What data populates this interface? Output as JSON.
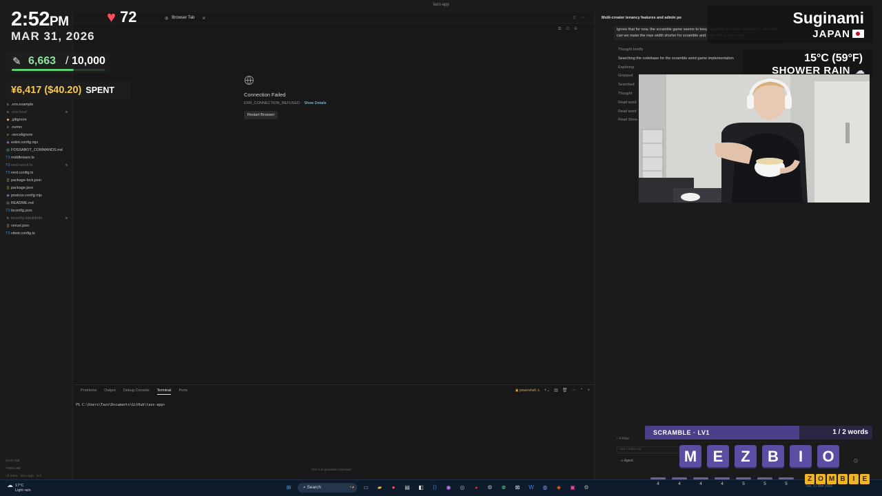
{
  "ide": {
    "app_title": "tazo-app",
    "files": [
      {
        "name": ".env.example",
        "icon": "≡",
        "dim": false,
        "dot": false
      },
      {
        "name": ".env.local",
        "icon": "≡",
        "dim": true,
        "dot": true
      },
      {
        "name": ".gitignore",
        "icon": "◆",
        "dim": false,
        "dot": false
      },
      {
        "name": ".nvmrc",
        "icon": "≡",
        "dim": false,
        "dot": false
      },
      {
        "name": ".vercelignore",
        "icon": "≡",
        "dim": false,
        "dot": false
      },
      {
        "name": "eslint.config.mjs",
        "icon": "◉",
        "dim": false,
        "dot": false
      },
      {
        "name": "FOSSABOT_COMMANDS.md",
        "icon": "▤",
        "dim": false,
        "dot": false
      },
      {
        "name": "middleware.ts",
        "icon": "TS",
        "dim": false,
        "dot": false
      },
      {
        "name": "next-env.d.ts",
        "icon": "TS",
        "dim": true,
        "dot": true
      },
      {
        "name": "next.config.ts",
        "icon": "TS",
        "dim": false,
        "dot": false
      },
      {
        "name": "package-lock.json",
        "icon": "{}",
        "dim": false,
        "dot": false
      },
      {
        "name": "package.json",
        "icon": "{}",
        "dim": false,
        "dot": false
      },
      {
        "name": "postcss.config.mjs",
        "icon": "◉",
        "dim": false,
        "dot": false
      },
      {
        "name": "README.md",
        "icon": "▤",
        "dim": false,
        "dot": false
      },
      {
        "name": "tsconfig.json",
        "icon": "TS",
        "dim": false,
        "dot": false
      },
      {
        "name": "tsconfig.tsbuildinfo",
        "icon": "≡",
        "dim": true,
        "dot": true
      },
      {
        "name": "vercel.json",
        "icon": "{}",
        "dim": false,
        "dot": false
      },
      {
        "name": "vitest.config.ts",
        "icon": "TS",
        "dim": false,
        "dot": false
      }
    ],
    "outline_label": "OUTLINE",
    "timeline_label": "TIMELINE",
    "status_branch": "main",
    "status_project": "tazo-app",
    "status_errors": "0  0",
    "browser_tab": "Browser Tab",
    "connection": {
      "title": "Connection Failed",
      "error": "ERR_CONNECTION_REFUSED",
      "details_link": "Show Details",
      "restart_button": "Restart Browser"
    },
    "panel_tabs": [
      "Problems",
      "Output",
      "Debug Console",
      "Terminal",
      "Ports"
    ],
    "panel_active": "Terminal",
    "shell_label": "powershell",
    "terminal_prompt": "PS C:\\Users\\Tazo\\Documents\\GitHub\\tazo-app>",
    "ctrl_hint": "Ctrl+K to generate command",
    "chat": {
      "title": "Multi-creator tenancy features and admin po",
      "message": "ignore that for now. the scramble game seems to keep repeating the same word for t... this, also can we make the max width shorter for scramble and make the answer lette...",
      "steps": [
        {
          "text": "Thought briefly",
          "bright": false
        },
        {
          "text": "Searching the codebase for the scramble word game implementation",
          "bright": true
        },
        {
          "text": "Exploring",
          "bright": false
        },
        {
          "text": "Grepped",
          "bright": false
        },
        {
          "text": "Searched",
          "bright": false
        },
        {
          "text": "Thought",
          "bright": false
        },
        {
          "text": "Read word",
          "bright": false
        },
        {
          "text": "Read word",
          "bright": false
        },
        {
          "text": "Read Strea",
          "bright": false
        }
      ],
      "files_label": "4 Files",
      "input_placeholder": "Add a follow-up",
      "agent_label": "Agent"
    }
  },
  "taskbar": {
    "temp": "17°C",
    "condition": "Light rain",
    "search_label": "Search",
    "clock": "Tue, 31 Mar 2026"
  },
  "overlay": {
    "time": "2:52",
    "ampm": "PM",
    "date": "MAR 31, 2026",
    "heart_rate": "72",
    "steps_current": "6,663",
    "steps_goal": "10,000",
    "steps_progress": 0.6663,
    "spent_yen": "¥6,417",
    "spent_usd": "($40.20)",
    "spent_label": "SPENT",
    "location_name": "Suginami",
    "location_country": "JAPAN",
    "weather_temp": "15°C (59°F)",
    "weather_condition": "SHOWER RAIN"
  },
  "scramble": {
    "title": "SCRAMBLE · LV1",
    "count": "1 / 2 words",
    "progress": 0.68,
    "letters": [
      "M",
      "E",
      "Z",
      "B",
      "I",
      "O"
    ],
    "slot_numbers": [
      "4",
      "4",
      "4",
      "4",
      "5",
      "5",
      "5"
    ],
    "answer": [
      "Z",
      "O",
      "M",
      "B",
      "I",
      "E"
    ]
  },
  "colors": {
    "accent_purple": "#5b4da1",
    "answer_gold": "#f0b429",
    "heart_red": "#ff4d5e",
    "steps_green": "#8fe39d"
  }
}
